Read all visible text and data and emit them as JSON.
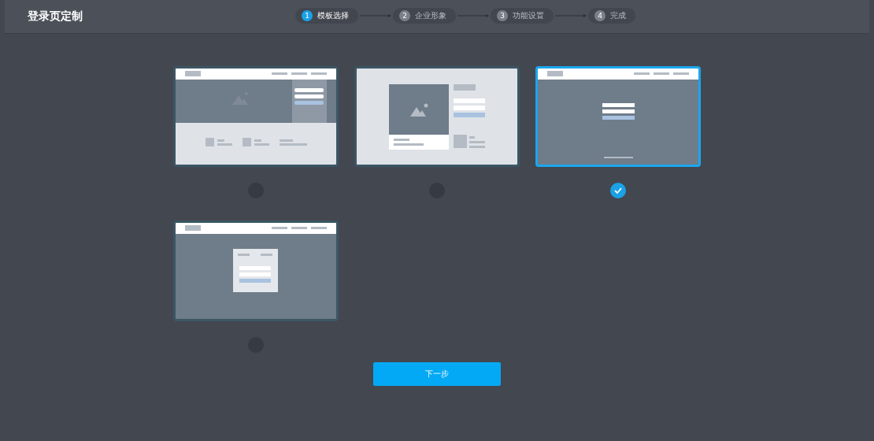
{
  "header": {
    "title": "登录页定制"
  },
  "steps": [
    {
      "number": "1",
      "label": "模板选择",
      "selected": true
    },
    {
      "number": "2",
      "label": "企业形象",
      "selected": false
    },
    {
      "number": "3",
      "label": "功能设置",
      "selected": false
    },
    {
      "number": "4",
      "label": "完成",
      "selected": false
    }
  ],
  "templates": [
    {
      "kind": "hero",
      "selected": false
    },
    {
      "kind": "split",
      "selected": false
    },
    {
      "kind": "center",
      "selected": true
    },
    {
      "kind": "boxed",
      "selected": false
    }
  ],
  "next_button": "下一步"
}
